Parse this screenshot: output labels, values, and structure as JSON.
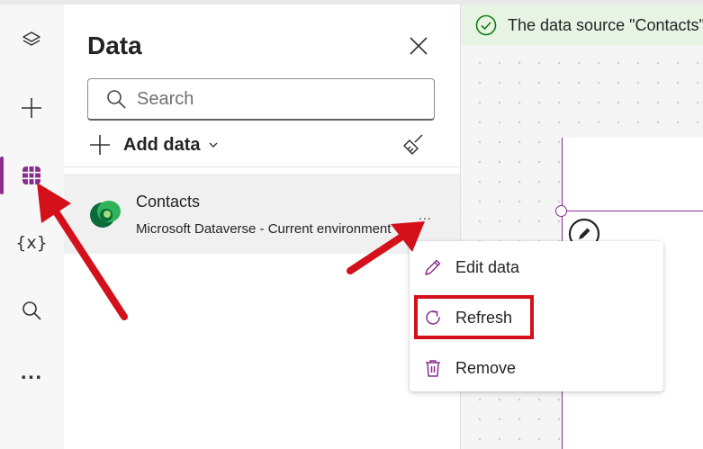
{
  "panel": {
    "title": "Data",
    "search_placeholder": "Search",
    "add_data_label": "Add data"
  },
  "sources": [
    {
      "name": "Contacts",
      "description": "Microsoft Dataverse - Current environment",
      "more_label": "..."
    }
  ],
  "rail": {
    "variables_label": "{x}",
    "more_label": "..."
  },
  "notification": {
    "text": "The data source \"Contacts\" was refreshed"
  },
  "context_menu": {
    "items": [
      {
        "label": "Edit data",
        "icon": "pencil-icon"
      },
      {
        "label": "Refresh",
        "icon": "refresh-icon"
      },
      {
        "label": "Remove",
        "icon": "trash-icon"
      }
    ]
  },
  "colors": {
    "accent": "#8a2d8f",
    "annotation_red": "#d4101a",
    "toast_background": "#e7f4e4",
    "toast_icon": "#107c10"
  }
}
